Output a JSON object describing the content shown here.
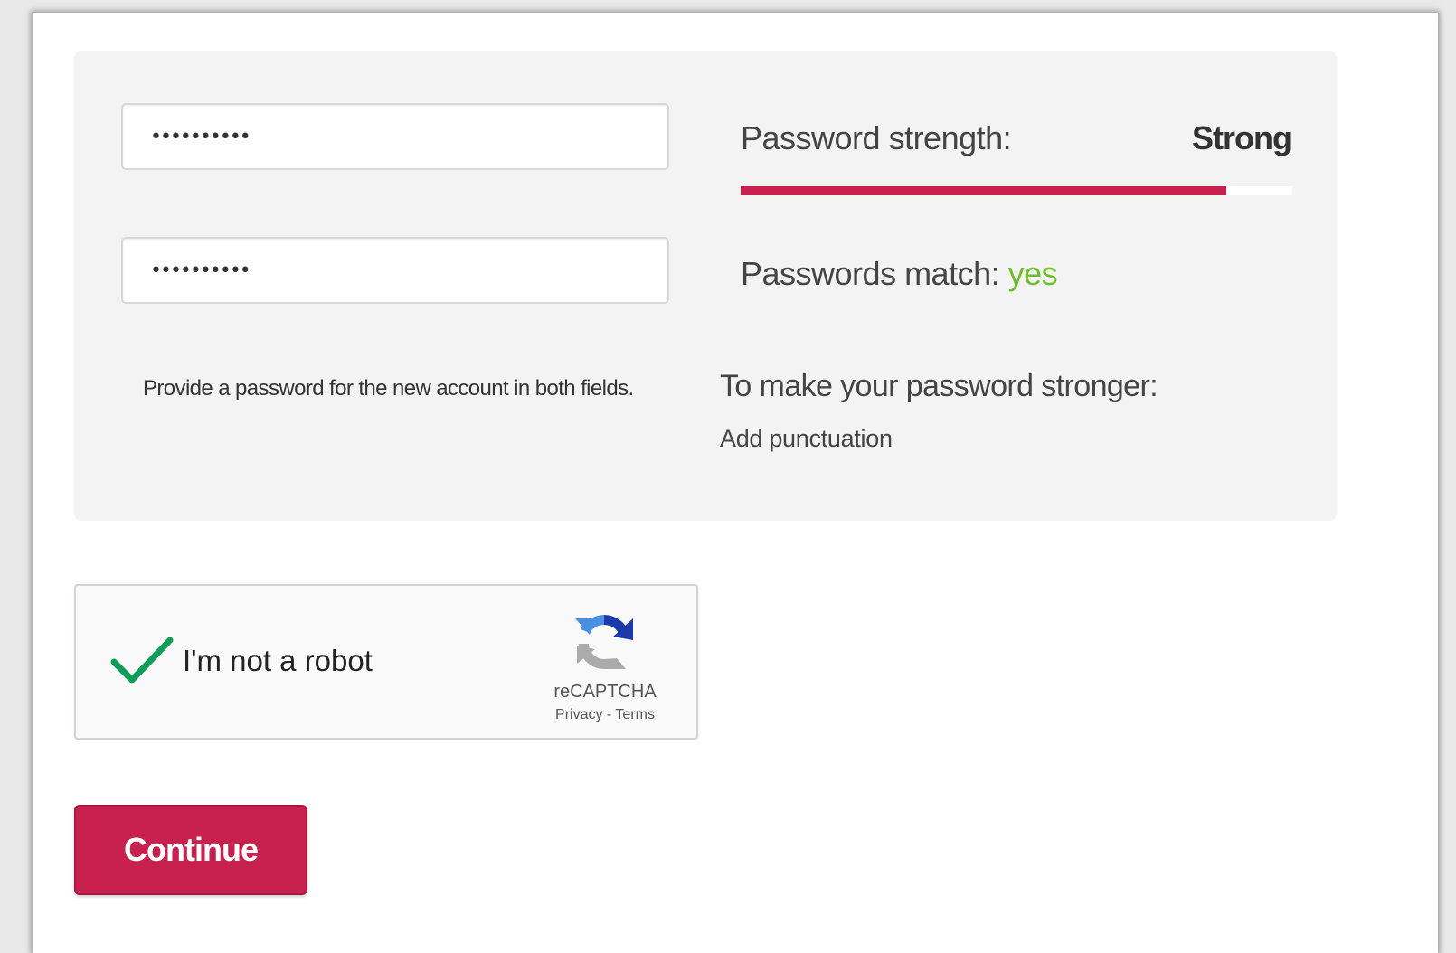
{
  "password_form": {
    "password_value": "••••••••••",
    "confirm_value": "••••••••••",
    "help_text": "Provide a password for the new account in both fields."
  },
  "strength": {
    "label": "Password strength:",
    "value": "Strong",
    "fraction": 0.88,
    "bar_color": "#c8204f"
  },
  "match": {
    "label": "Passwords match:",
    "value": "yes",
    "value_color": "#6fbe2f"
  },
  "tips": {
    "title": "To make your password stronger:",
    "items": [
      "Add punctuation"
    ]
  },
  "recaptcha": {
    "checked": true,
    "label": "I'm not a robot",
    "brand": "reCAPTCHA",
    "privacy": "Privacy",
    "separator": "-",
    "terms": "Terms",
    "icons": [
      "checkmark-icon",
      "recaptcha-logo-icon"
    ]
  },
  "actions": {
    "continue_label": "Continue",
    "accent": "#c8204f"
  }
}
